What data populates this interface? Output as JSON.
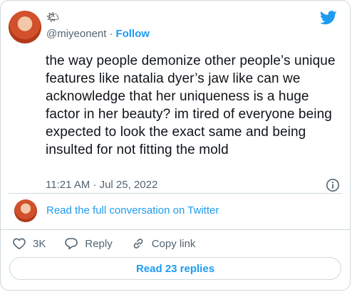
{
  "tweet": {
    "weather_emoji": "🌤",
    "handle": "@miyeonent",
    "separator": "·",
    "follow_label": "Follow",
    "text": "the way people demonize other people’s unique features like natalia dyer’s jaw like can we acknowledge that her uniqueness is a huge factor in her beauty? im tired of everyone being expected to look the exact same and being insulted for not fitting the mold",
    "timestamp": "11:21 AM · Jul 25, 2022",
    "read_conversation": "Read the full conversation on Twitter"
  },
  "actions": {
    "likes": "3K",
    "reply_label": "Reply",
    "copy_link_label": "Copy link"
  },
  "footer": {
    "read_replies_label": "Read 23 replies"
  },
  "colors": {
    "accent": "#1d9bf0",
    "muted": "#536471",
    "text": "#0f1419",
    "border": "#cfd9de"
  },
  "icons": [
    "twitter-bird-icon",
    "info-icon",
    "heart-icon",
    "reply-icon",
    "link-icon"
  ]
}
